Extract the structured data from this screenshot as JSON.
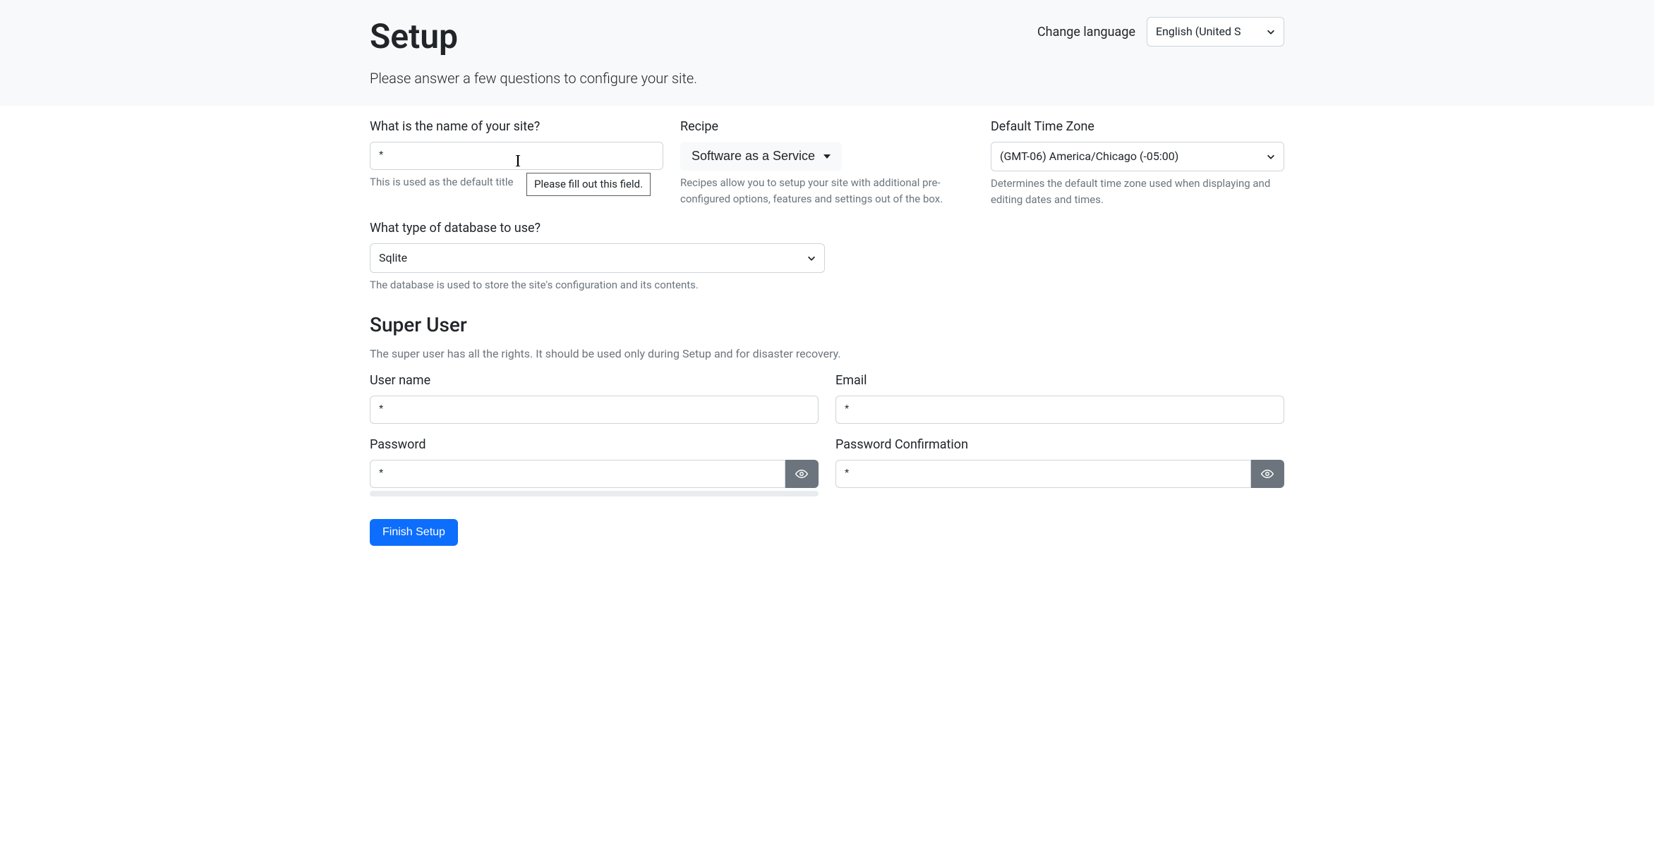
{
  "header": {
    "title": "Setup",
    "subtitle": "Please answer a few questions to configure your site.",
    "change_language_label": "Change language",
    "language_selected": "English (United S"
  },
  "site": {
    "name_label": "What is the name of your site?",
    "name_placeholder": "*",
    "name_help": "This is used as the default title",
    "tooltip": "Please fill out this field."
  },
  "recipe": {
    "label": "Recipe",
    "selected": "Software as a Service",
    "help": "Recipes allow you to setup your site with additional pre-configured options, features and settings out of the box."
  },
  "timezone": {
    "label": "Default Time Zone",
    "selected": "(GMT-06) America/Chicago (-05:00)",
    "help": "Determines the default time zone used when displaying and editing dates and times."
  },
  "database": {
    "label": "What type of database to use?",
    "selected": "Sqlite",
    "help": "The database is used to store the site's configuration and its contents."
  },
  "superuser": {
    "heading": "Super User",
    "desc": "The super user has all the rights. It should be used only during Setup and for disaster recovery.",
    "username_label": "User name",
    "username_placeholder": "*",
    "email_label": "Email",
    "email_placeholder": "*",
    "password_label": "Password",
    "password_placeholder": "*",
    "password_confirm_label": "Password Confirmation",
    "password_confirm_placeholder": "*"
  },
  "submit": {
    "label": "Finish Setup"
  }
}
